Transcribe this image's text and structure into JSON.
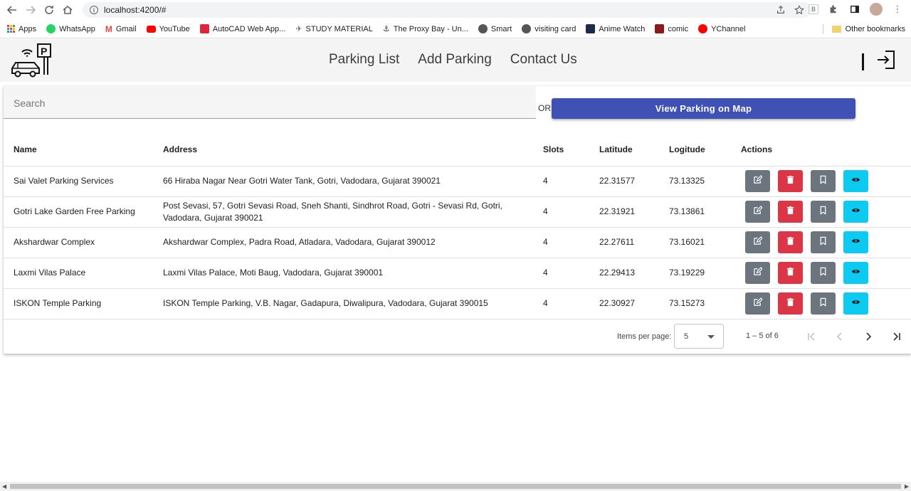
{
  "browser": {
    "url": "localhost:4200/#",
    "bookmarks": [
      {
        "label": "Apps",
        "color": "#ea4335"
      },
      {
        "label": "WhatsApp",
        "color": "#25d366"
      },
      {
        "label": "Gmail",
        "color": "#ea4335"
      },
      {
        "label": "YouTube",
        "color": "#ff0000"
      },
      {
        "label": "AutoCAD Web App...",
        "color": "#e0263b"
      },
      {
        "label": "STUDY MATERIAL",
        "color": "#5f6368"
      },
      {
        "label": "The Proxy Bay - Un...",
        "color": "#333333"
      },
      {
        "label": "Smart",
        "color": "#555555"
      },
      {
        "label": "visiting card",
        "color": "#555555"
      },
      {
        "label": "Anime Watch",
        "color": "#1d2a4b"
      },
      {
        "label": "comic",
        "color": "#8b1a1a"
      },
      {
        "label": "YChannel",
        "color": "#ff0000"
      }
    ],
    "other_bookmarks": "Other bookmarks"
  },
  "header": {
    "nav": [
      "Parking List",
      "Add Parking",
      "Contact Us"
    ]
  },
  "search": {
    "placeholder": "Search"
  },
  "or_label": "OR",
  "map_button": "View Parking on Map",
  "table": {
    "headers": [
      "Name",
      "Address",
      "Slots",
      "Latitude",
      "Logitude",
      "Actions"
    ],
    "rows": [
      {
        "name": "Sai Valet Parking Services",
        "address": "66 Hiraba Nagar Near Gotri Water Tank, Gotri, Vadodara, Gujarat 390021",
        "slots": "4",
        "lat": "22.31577",
        "lng": "73.13325"
      },
      {
        "name": "Gotri Lake Garden Free Parking",
        "address": "Post Sevasi, 57, Gotri Sevasi Road, Sneh Shanti, Sindhrot Road, Gotri - Sevasi Rd, Gotri, Vadodara, Gujarat 390021",
        "slots": "4",
        "lat": "22.31921",
        "lng": "73.13861"
      },
      {
        "name": "Akshardwar Complex",
        "address": "Akshardwar Complex, Padra Road, Atladara, Vadodara, Gujarat 390012",
        "slots": "4",
        "lat": "22.27611",
        "lng": "73.16021"
      },
      {
        "name": "Laxmi Vilas Palace",
        "address": "Laxmi Vilas Palace, Moti Baug, Vadodara, Gujarat 390001",
        "slots": "4",
        "lat": "22.29413",
        "lng": "73.19229"
      },
      {
        "name": "ISKON Temple Parking",
        "address": "ISKON Temple Parking, V.B. Nagar, Gadapura, Diwalipura, Vadodara, Gujarat 390015",
        "slots": "4",
        "lat": "22.30927",
        "lng": "73.15273"
      }
    ]
  },
  "paginator": {
    "label": "Items per page:",
    "page_size": "5",
    "range": "1 – 5 of 6"
  },
  "colors": {
    "primary": "#3f51b5",
    "edit": "#6c757d",
    "delete": "#dc3545",
    "view": "#0dcaf0"
  }
}
